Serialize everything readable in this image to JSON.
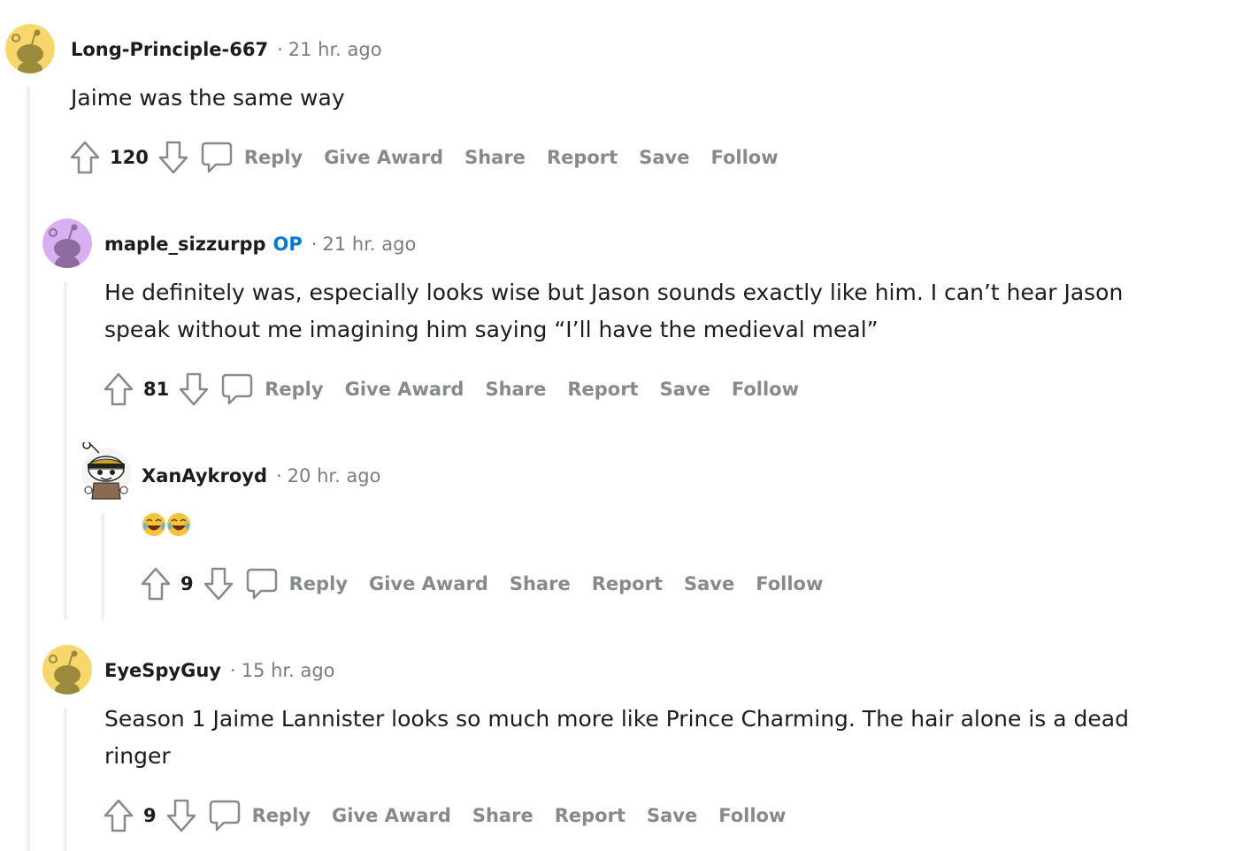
{
  "comments": [
    {
      "username": "Long-Principle-667",
      "op_badge": "",
      "separator": "·",
      "time": "21 hr. ago",
      "body": "Jaime was the same way",
      "score": "120",
      "avatar_color": "#f7d76b"
    },
    {
      "username": "maple_sizzurpp",
      "op_badge": "OP",
      "separator": "·",
      "time": "21 hr. ago",
      "body": "He definitely was, especially looks wise but Jason sounds exactly like him. I can’t hear Jason speak without me imagining him saying “I’ll have the medieval meal”",
      "score": "81",
      "avatar_color": "#d8b0f2"
    },
    {
      "username": "XanAykroyd",
      "op_badge": "",
      "separator": "·",
      "time": "20 hr. ago",
      "body": "😂😂",
      "score": "9",
      "avatar_color": "#ffffff"
    },
    {
      "username": "EyeSpyGuy",
      "op_badge": "",
      "separator": "·",
      "time": "15 hr. ago",
      "body": "Season 1 Jaime Lannister looks so much more like Prince Charming. The hair alone is a dead ringer",
      "score": "9",
      "avatar_color": "#f7d76b"
    }
  ],
  "actions": {
    "reply": "Reply",
    "give_award": "Give Award",
    "share": "Share",
    "report": "Report",
    "save": "Save",
    "follow": "Follow"
  },
  "icons": {
    "upvote": "upvote-arrow-icon",
    "downvote": "downvote-arrow-icon",
    "reply": "comment-bubble-icon"
  },
  "colors": {
    "op": "#0079d3",
    "muted": "#878a8c",
    "thread_line": "#edeff1"
  }
}
